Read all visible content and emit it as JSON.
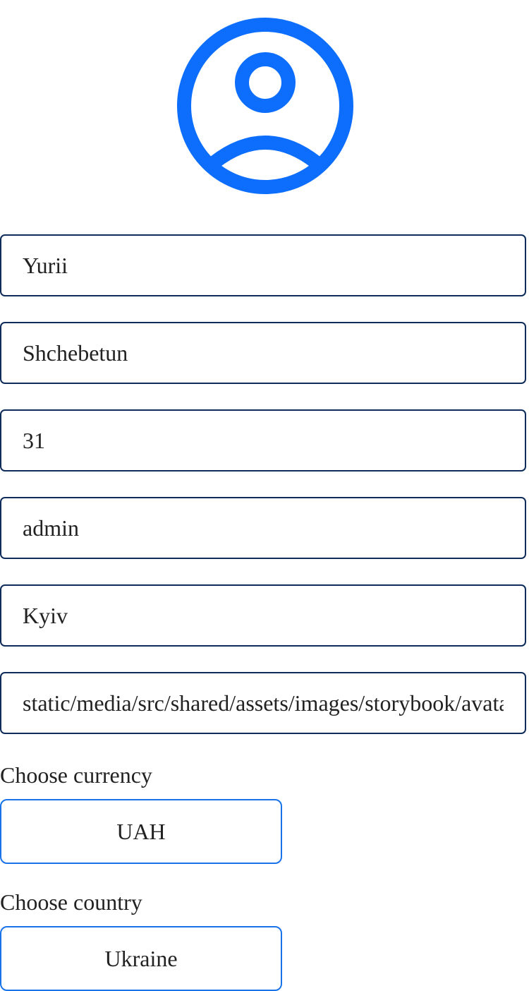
{
  "avatar": {
    "icon": "user-circle-icon",
    "color": "#0d6efd"
  },
  "profile": {
    "first_name": "Yurii",
    "last_name": "Shchebetun",
    "age": "31",
    "role": "admin",
    "city": "Kyiv",
    "avatar_path": "static/media/src/shared/assets/images/storybook/avatar"
  },
  "currency": {
    "label": "Choose currency",
    "value": "UAH"
  },
  "country": {
    "label": "Choose country",
    "value": "Ukraine"
  },
  "colors": {
    "field_border": "#0f2d5a",
    "select_border": "#1a73e8",
    "text": "#222222"
  }
}
